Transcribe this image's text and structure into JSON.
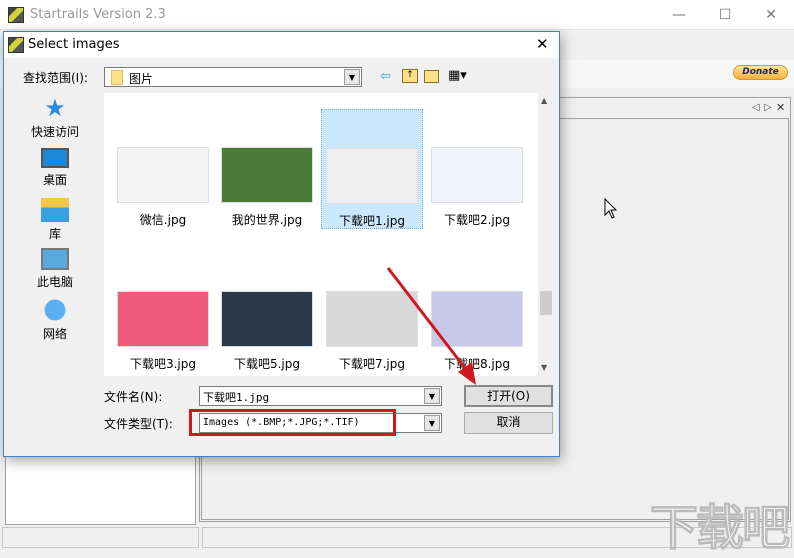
{
  "main_window": {
    "title": "Startrails Version 2.3",
    "donate_label": "Donate",
    "minimize": "—",
    "maximize": "☐",
    "close": "✕",
    "tab_prev": "◁",
    "tab_next": "▷",
    "tab_close": "✕"
  },
  "dialog": {
    "title": "Select images",
    "close": "✕",
    "look_in_label": "查找范围(I):",
    "look_in_value": "图片",
    "places": [
      {
        "label": "快速访问",
        "icon": "star-icon"
      },
      {
        "label": "桌面",
        "icon": "desktop-icon"
      },
      {
        "label": "库",
        "icon": "library-icon"
      },
      {
        "label": "此电脑",
        "icon": "computer-icon"
      },
      {
        "label": "网络",
        "icon": "network-icon"
      }
    ],
    "files": [
      {
        "name": "微信.jpg",
        "color": "#f4f4f4",
        "selected": false
      },
      {
        "name": "我的世界.jpg",
        "color": "#4a7a3a",
        "selected": false
      },
      {
        "name": "下载吧1.jpg",
        "color": "#eeeeee",
        "selected": true
      },
      {
        "name": "下载吧2.jpg",
        "color": "#f0f4fa",
        "selected": false
      },
      {
        "name": "下载吧3.jpg",
        "color": "#ef5a7a",
        "selected": false
      },
      {
        "name": "下载吧5.jpg",
        "color": "#2a3a4a",
        "selected": false
      },
      {
        "name": "下载吧7.jpg",
        "color": "#d8d8d8",
        "selected": false
      },
      {
        "name": "下载吧8.jpg",
        "color": "#c8c8e8",
        "selected": false
      }
    ],
    "filename_label": "文件名(N):",
    "filename_value": "下载吧1.jpg",
    "filetype_label": "文件类型(T):",
    "filetype_value": "Images (*.BMP;*.JPG;*.TIF)",
    "open_label": "打开(O)",
    "cancel_label": "取消"
  },
  "watermark": "下载吧"
}
